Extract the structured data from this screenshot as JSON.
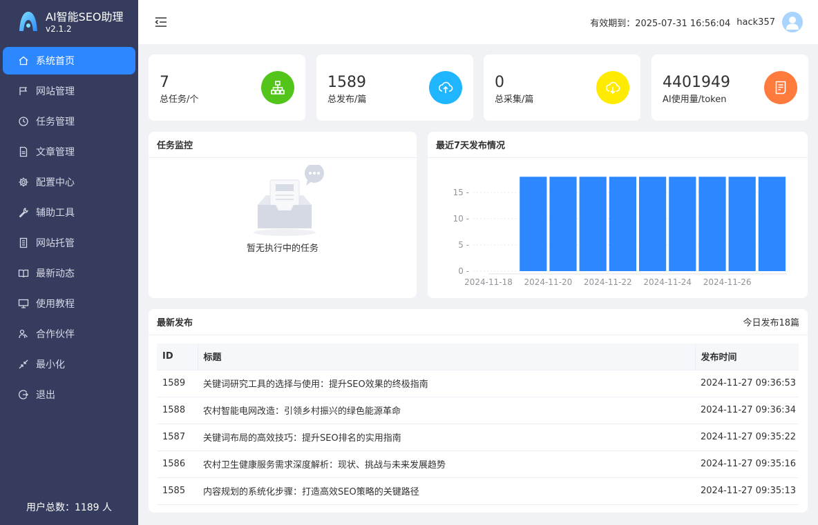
{
  "app": {
    "title": "AI智能SEO助理",
    "version": "v2.1.2"
  },
  "sidebar": {
    "items": [
      {
        "label": "系统首页",
        "icon": "home-icon",
        "active": true
      },
      {
        "label": "网站管理",
        "icon": "flag-icon",
        "active": false
      },
      {
        "label": "任务管理",
        "icon": "clock-icon",
        "active": false
      },
      {
        "label": "文章管理",
        "icon": "document-icon",
        "active": false
      },
      {
        "label": "配置中心",
        "icon": "gear-icon",
        "active": false
      },
      {
        "label": "辅助工具",
        "icon": "wrench-icon",
        "active": false
      },
      {
        "label": "网站托管",
        "icon": "notebook-icon",
        "active": false
      },
      {
        "label": "最新动态",
        "icon": "book-icon",
        "active": false
      },
      {
        "label": "使用教程",
        "icon": "monitor-icon",
        "active": false
      },
      {
        "label": "合作伙伴",
        "icon": "partner-icon",
        "active": false
      },
      {
        "label": "最小化",
        "icon": "minimize-icon",
        "active": false
      },
      {
        "label": "退出",
        "icon": "logout-icon",
        "active": false
      }
    ],
    "footer": "用户总数：1189 人"
  },
  "header": {
    "expire_label": "有效期到：2025-07-31 16:56:04",
    "username": "hack357"
  },
  "stats": [
    {
      "value": "7",
      "label": "总任务/个",
      "color": "#52c41a",
      "icon": "sitemap-icon"
    },
    {
      "value": "1589",
      "label": "总发布/篇",
      "color": "#1fb5ff",
      "icon": "cloud-upload-icon"
    },
    {
      "value": "0",
      "label": "总采集/篇",
      "color": "#ffeb00",
      "icon": "cloud-download-icon"
    },
    {
      "value": "4401949",
      "label": "AI使用量/token",
      "color": "#ff7a3d",
      "icon": "receipt-icon"
    }
  ],
  "monitor": {
    "title": "任务监控",
    "empty_text": "暂无执行中的任务"
  },
  "weekly_chart_title": "最近7天发布情况",
  "chart_data": {
    "type": "bar",
    "categories": [
      "2024-11-18",
      "2024-11-19",
      "2024-11-20",
      "2024-11-21",
      "2024-11-22",
      "2024-11-23",
      "2024-11-24",
      "2024-11-25",
      "2024-11-26",
      "2024-11-27"
    ],
    "values": [
      0,
      18,
      18,
      18,
      18,
      18,
      18,
      18,
      18,
      18
    ],
    "xlabel": "",
    "ylabel": "",
    "ylim": [
      0,
      20
    ],
    "yticks": [
      0,
      5,
      10,
      15
    ],
    "xtick_labels": [
      "2024-11-18",
      "2024-11-20",
      "2024-11-22",
      "2024-11-24",
      "2024-11-26"
    ],
    "bar_color": "#2d88ff",
    "grid": true
  },
  "recent": {
    "title": "最新发布",
    "today": "今日发布18篇",
    "columns": [
      "ID",
      "标题",
      "发布时间"
    ],
    "rows": [
      [
        "1589",
        "关键词研究工具的选择与使用：提升SEO效果的终极指南",
        "2024-11-27 09:36:53"
      ],
      [
        "1588",
        "农村智能电网改造：引领乡村振兴的绿色能源革命",
        "2024-11-27 09:36:34"
      ],
      [
        "1587",
        "关键词布局的高效技巧：提升SEO排名的实用指南",
        "2024-11-27 09:35:22"
      ],
      [
        "1586",
        "农村卫生健康服务需求深度解析：现状、挑战与未来发展趋势",
        "2024-11-27 09:35:16"
      ],
      [
        "1585",
        "内容规划的系统化步骤：打造高效SEO策略的关键路径",
        "2024-11-27 09:35:13"
      ]
    ]
  }
}
